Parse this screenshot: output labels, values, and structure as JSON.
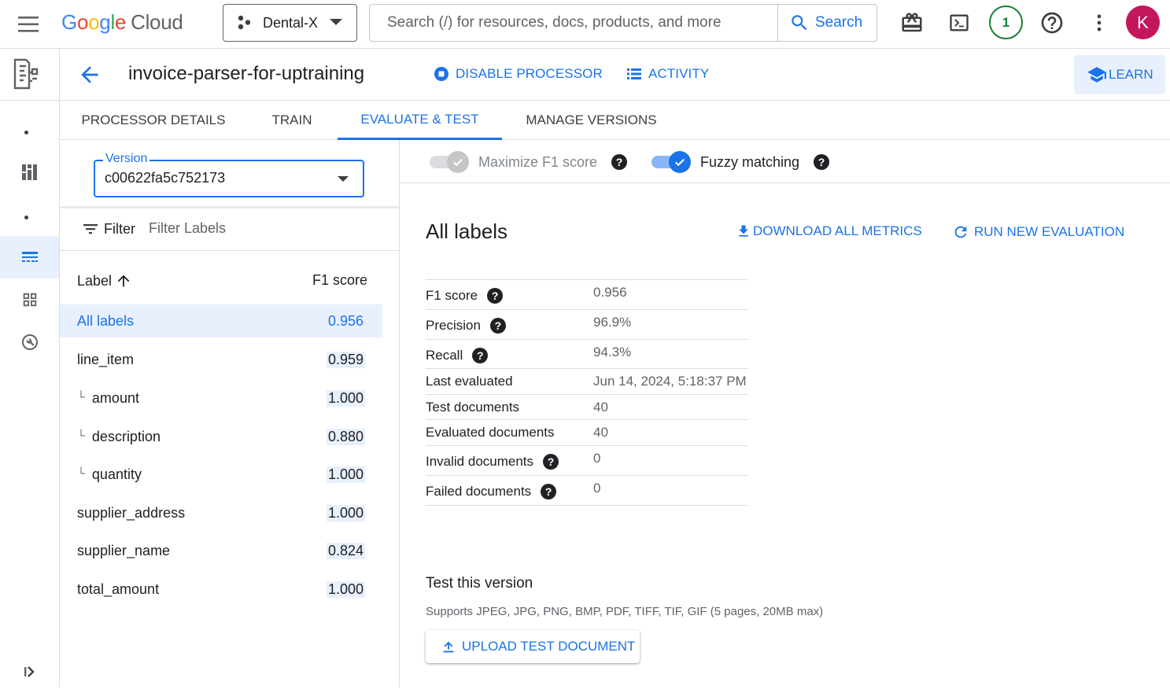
{
  "header": {
    "logo": {
      "g1": "G",
      "o1": "o",
      "o2": "o",
      "g2": "g",
      "l": "l",
      "e": "e",
      "cloud": "Cloud"
    },
    "project": "Dental-X",
    "search_placeholder": "Search (/) for resources, docs, products, and more",
    "search_button": "Search",
    "notifications_count": "1",
    "avatar_letter": "K",
    "icons": [
      "menu-icon",
      "gift-icon",
      "cloud-shell-icon",
      "help-icon",
      "more-vert-icon"
    ]
  },
  "titlebar": {
    "title": "invoice-parser-for-uptraining",
    "disable_label": "DISABLE PROCESSOR",
    "activity_label": "ACTIVITY",
    "learn_label": "LEARN"
  },
  "tabs": [
    {
      "label": "PROCESSOR DETAILS"
    },
    {
      "label": "TRAIN"
    },
    {
      "label": "EVALUATE & TEST"
    },
    {
      "label": "MANAGE VERSIONS"
    }
  ],
  "active_tab": "EVALUATE & TEST",
  "left_panel": {
    "version_label": "Version",
    "version_value": "c00622fa5c752173",
    "filter_label": "Filter",
    "filter_placeholder": "Filter Labels",
    "col_label": "Label",
    "col_f1": "F1 score",
    "rows": [
      {
        "name": "All labels",
        "score": "0.956",
        "selected": true,
        "child": false
      },
      {
        "name": "line_item",
        "score": "0.959",
        "selected": false,
        "child": false
      },
      {
        "name": "amount",
        "score": "1.000",
        "selected": false,
        "child": true
      },
      {
        "name": "description",
        "score": "0.880",
        "selected": false,
        "child": true
      },
      {
        "name": "quantity",
        "score": "1.000",
        "selected": false,
        "child": true
      },
      {
        "name": "supplier_address",
        "score": "1.000",
        "selected": false,
        "child": false
      },
      {
        "name": "supplier_name",
        "score": "0.824",
        "selected": false,
        "child": false
      },
      {
        "name": "total_amount",
        "score": "1.000",
        "selected": false,
        "child": false
      }
    ],
    "child_marker": "└"
  },
  "main": {
    "toggles": [
      {
        "label": "Maximize F1 score",
        "on": false,
        "disabled": true
      },
      {
        "label": "Fuzzy matching",
        "on": true,
        "disabled": false
      }
    ],
    "section_title": "All labels",
    "download_label": "DOWNLOAD ALL METRICS",
    "run_label": "RUN NEW EVALUATION",
    "metrics": [
      {
        "label": "F1 score",
        "value": "0.956",
        "help": true
      },
      {
        "label": "Precision",
        "value": "96.9%",
        "help": true
      },
      {
        "label": "Recall",
        "value": "94.3%",
        "help": true
      },
      {
        "label": "Last evaluated",
        "value": "Jun 14, 2024, 5:18:37 PM",
        "help": false
      },
      {
        "label": "Test documents",
        "value": "40",
        "help": false
      },
      {
        "label": "Evaluated documents",
        "value": "40",
        "help": false
      },
      {
        "label": "Invalid documents",
        "value": "0",
        "help": true
      },
      {
        "label": "Failed documents",
        "value": "0",
        "help": true
      }
    ],
    "test_title": "Test this version",
    "test_subtitle": "Supports JPEG, JPG, PNG, BMP, PDF, TIFF, TIF, GIF (5 pages, 20MB max)",
    "upload_label": "UPLOAD TEST DOCUMENT",
    "help_glyph": "?"
  },
  "colors": {
    "accent": "#1a73e8",
    "selected_bg": "#e8f0fe",
    "avatar": "#c2185b",
    "notif": "#188038"
  }
}
